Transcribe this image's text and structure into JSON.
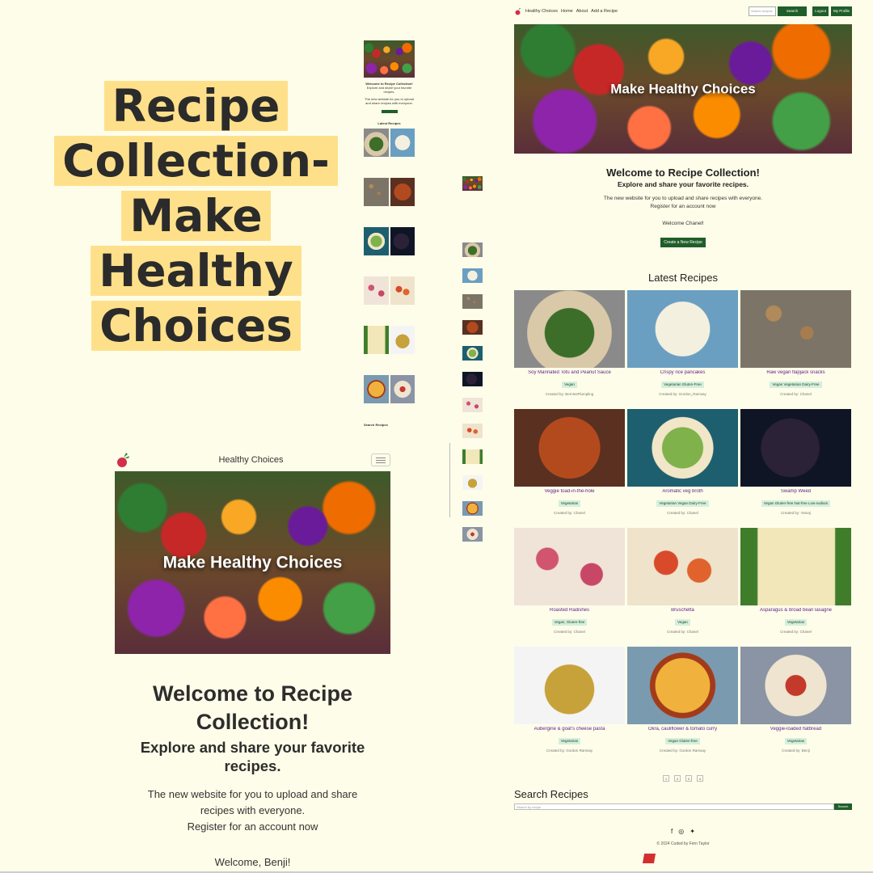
{
  "big_title": [
    "Recipe",
    "Collection-",
    "Make",
    "Healthy",
    "Choices"
  ],
  "brand": "Healthy Choices",
  "hero_text": "Make Healthy Choices",
  "welcome": {
    "title": "Welcome to Recipe Collection!",
    "subtitle": "Explore and share your favorite recipes.",
    "desc1": "The new website for you to upload and share recipes with everyone.",
    "desc2": "Register for an account now",
    "mobile_hello": "Welcome, Benji!",
    "desk_hello": "Welcome Chanel!",
    "create_button": "Create a New Recipe"
  },
  "desktop_nav": {
    "links": [
      "Healthy Choices",
      "Home",
      "About",
      "Add a Recipe"
    ],
    "search_placeholder": "Search recipes",
    "search_button": "Search",
    "logout": "Logout",
    "profile": "My Profile"
  },
  "latest_title": "Latest Recipes",
  "recipes": [
    {
      "title": "Soy Marinated Tofu and Peanut Sauce",
      "tags": "Vegan",
      "by": "Created by: BerniesPlumpling"
    },
    {
      "title": "Crispy rice pancakes",
      "tags": "Vegetarian Gluten-Free",
      "by": "Created by: Gordon_Ramsay"
    },
    {
      "title": "Raw vegan flapjack snacks",
      "tags": "Vegan Vegetarian Dairy-Free",
      "by": "Created by: Chanel"
    },
    {
      "title": "Veggie toad-in-the-hole",
      "tags": "Vegetarian",
      "by": "Created by: Chanel"
    },
    {
      "title": "Aromatic veg broth",
      "tags": "Vegetarian Vegan Dairy-Free",
      "by": "Created by: Chanel"
    },
    {
      "title": "Swamp Weed",
      "tags": "Vegan Gluten-free Nut-free Low-sodium",
      "by": "Created by: Yasraj"
    },
    {
      "title": "Roasted Radishes",
      "tags": "Vegan, Gluten-free",
      "by": "Created by: Chanel"
    },
    {
      "title": "Bruschetta",
      "tags": "Vegan",
      "by": "Created by: Chanel"
    },
    {
      "title": "Asparagus & broad bean lasagne",
      "tags": "Vegetarian",
      "by": "Created by: Chanel"
    },
    {
      "title": "Aubergine & goat's cheese pasta",
      "tags": "Vegetarian",
      "by": "Created by: Gordon Ramsay"
    },
    {
      "title": "Okra, cauliflower & tomato curry",
      "tags": "Vegan Gluten-free",
      "by": "Created by: Gordon Ramsay"
    },
    {
      "title": "Veggie-loaded flatbread",
      "tags": "Vegetarian",
      "by": "Created by: Benji"
    }
  ],
  "pagination": [
    "1",
    "2",
    "3",
    "4"
  ],
  "search_title": "Search Recipes",
  "search_placeholder": "Search by recipe",
  "search_button": "Search",
  "footer": "© 2024 Coded by Fern Taylor"
}
